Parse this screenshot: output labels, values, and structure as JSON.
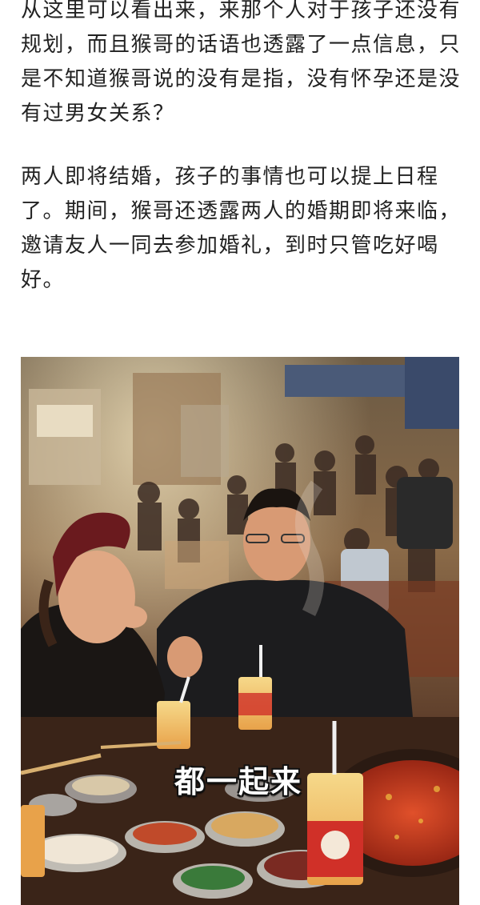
{
  "article": {
    "paragraphs": [
      "从这里可以看出来，来那个人对于孩子还没有规划，而且猴哥的话语也透露了一点信息，只是不知道猴哥说的没有是指，没有怀孕还是没有过男女关系？",
      "两人即将结婚，孩子的事情也可以提上日程了。期间，猴哥还透露两人的婚期即将来临，邀请友人一同去参加婚礼，到时只管吃好喝好。"
    ],
    "image": {
      "caption": "都一起来"
    }
  }
}
